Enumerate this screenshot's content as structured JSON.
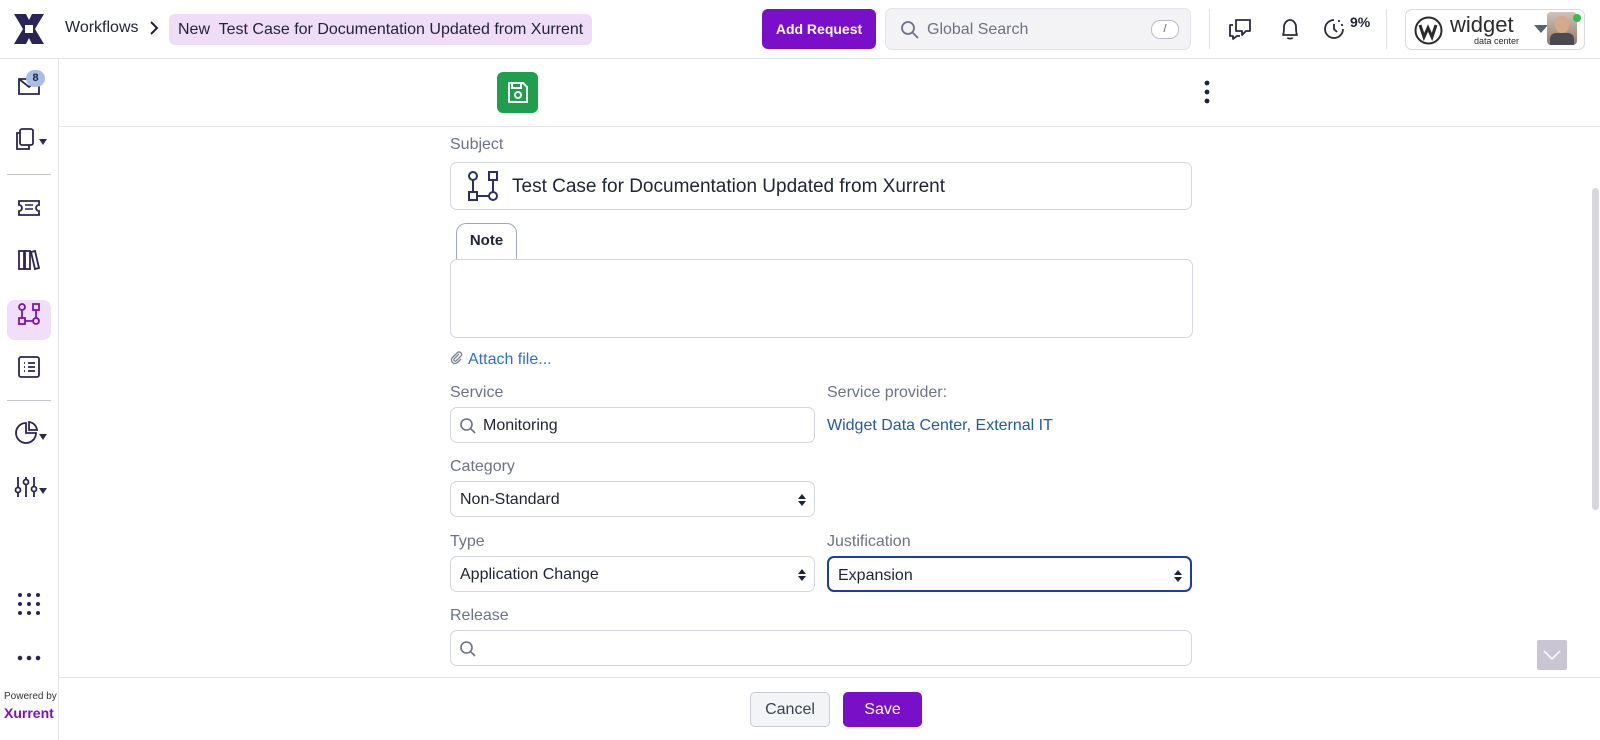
{
  "header": {
    "breadcrumb_root": "Workflows",
    "breadcrumb_current_prefix": "New",
    "breadcrumb_current_title": "Test Case for Documentation Updated from Xurrent",
    "add_request_label": "Add Request",
    "search_placeholder": "Global Search",
    "search_shortcut": "/",
    "timer_percent": "9%",
    "account_name": "widget",
    "account_subtitle": "data center"
  },
  "sidebar": {
    "inbox_badge": "8",
    "powered_by": "Powered by",
    "brand": "Xurrent",
    "items": [
      {
        "name": "inbox-icon"
      },
      {
        "name": "requests-icon"
      },
      {
        "name": "tickets-icon"
      },
      {
        "name": "library-icon"
      },
      {
        "name": "workflows-icon",
        "active": true
      },
      {
        "name": "list-icon"
      },
      {
        "name": "analytics-icon"
      },
      {
        "name": "settings-icon"
      },
      {
        "name": "apps-grid-icon"
      },
      {
        "name": "more-icon"
      }
    ]
  },
  "form": {
    "subject_label": "Subject",
    "subject_value": "Test Case for Documentation Updated from Xurrent",
    "note_tab": "Note",
    "note_value": "",
    "attach_label": "Attach file...",
    "service_label": "Service",
    "service_value": "Monitoring",
    "service_provider_label": "Service provider:",
    "service_provider_value": "Widget Data Center, External IT",
    "category_label": "Category",
    "category_value": "Non-Standard",
    "type_label": "Type",
    "type_value": "Application Change",
    "justification_label": "Justification",
    "justification_value": "Expansion",
    "release_label": "Release",
    "release_value": ""
  },
  "footer": {
    "cancel_label": "Cancel",
    "save_label": "Save"
  },
  "colors": {
    "brand_purple": "#7a0fc9",
    "save_green": "#1f9e4b",
    "link_blue": "#2b6fd8",
    "crumb_highlight": "#efdcf6"
  }
}
